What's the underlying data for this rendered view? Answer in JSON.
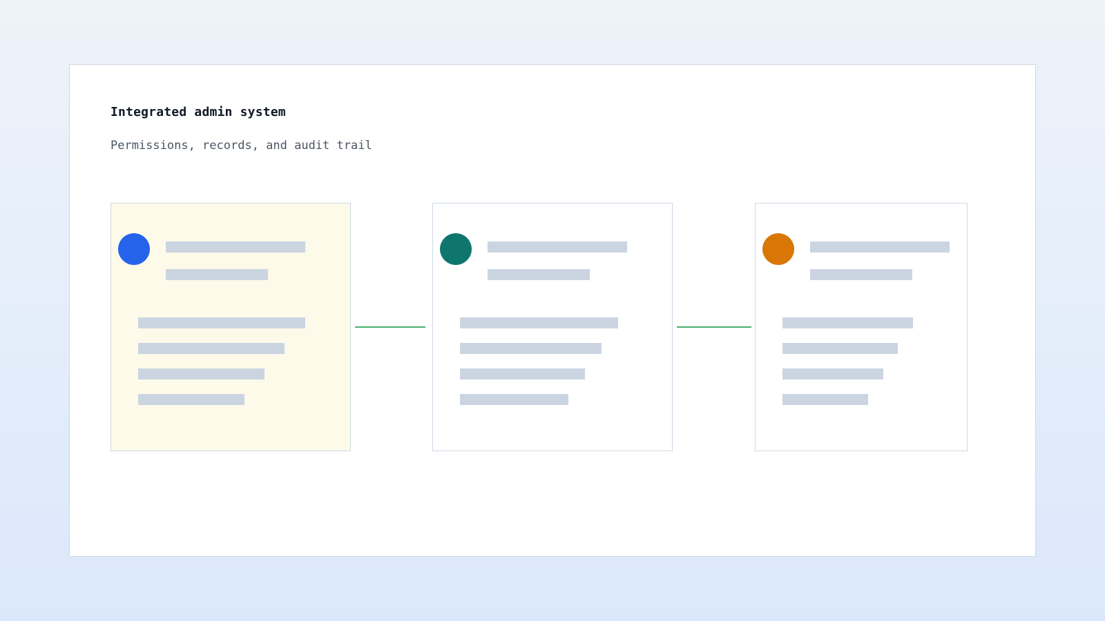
{
  "header": {
    "title": "Integrated admin system",
    "subtitle": "Permissions, records, and audit trail"
  },
  "colors": {
    "card_1_accent": "#2563eb",
    "card_2_accent": "#0f766e",
    "card_3_accent": "#d97706",
    "placeholder_bar": "#cbd5e1",
    "connector": "#47b06c",
    "highlight_background": "#fefaea"
  },
  "cards": [
    {
      "highlighted": true
    },
    {
      "highlighted": false
    },
    {
      "highlighted": false
    }
  ]
}
